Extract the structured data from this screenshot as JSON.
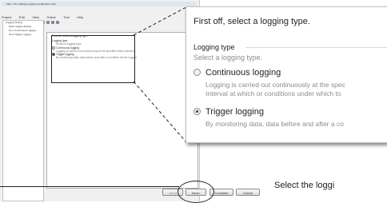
{
  "app": {
    "window_title": "Main - PLC Setting Logging Configuration Tool",
    "menu": [
      "Project",
      "Edit",
      "View",
      "Online",
      "Tool",
      "Help"
    ],
    "tree": [
      "Logging Setting",
      "Data Logging Setting",
      "No.1 Continuous Logging",
      "No.2 Trigger Logging"
    ],
    "tabs": [
      "Logging type",
      "Sampling",
      "Data",
      "CSV output",
      "Save",
      "File Switching timing",
      "Folder/File",
      "Latch"
    ],
    "mini": {
      "heading": "First off, select a logging type.",
      "group": "Logging type",
      "group_sub": "Select a logging type.",
      "opt1": "Continuous logging",
      "opt1_desc": "Logging is carried out continuously at the specified data collection.",
      "opt2": "Trigger logging",
      "opt2_desc": "By monitoring data, data before and after a condition will be logged."
    }
  },
  "buttons": {
    "back": "<Back",
    "next": "Next>",
    "complete": "Complete",
    "cancel": "Cancel"
  },
  "zoom": {
    "title": "First off, select a logging type.",
    "group_label": "Logging type",
    "group_hint": "Select a logging type.",
    "option1_label": "Continuous logging",
    "option1_desc_line1": "Logging is carried out continuously at the spec",
    "option1_desc_line2": "Interval at which or conditions under which to",
    "option2_label": "Trigger logging",
    "option2_desc": "By monitoring data, data before and after a co",
    "selected": "Trigger logging"
  },
  "callout": {
    "text": "Select the loggi"
  }
}
